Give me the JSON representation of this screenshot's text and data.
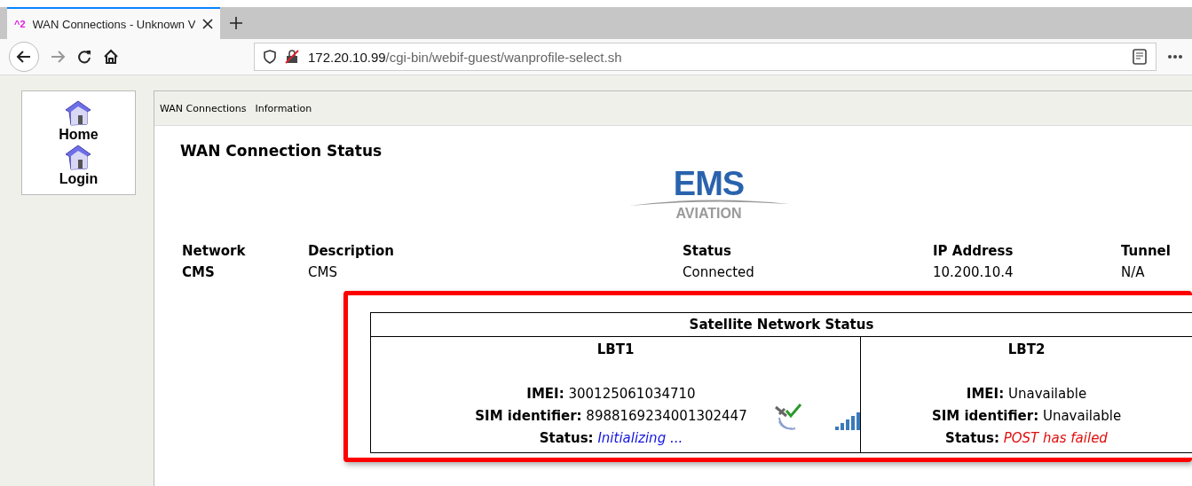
{
  "browser": {
    "tab": {
      "badge": "^2",
      "title": "WAN Connections - Unknown V",
      "selected": true
    },
    "url": {
      "host": "172.20.10.99",
      "path": "/cgi-bin/webif-guest/wanprofile-select.sh"
    }
  },
  "sidebar": {
    "items": [
      {
        "label": "Home"
      },
      {
        "label": "Login"
      }
    ]
  },
  "menu": [
    "WAN Connections",
    "Information"
  ],
  "title": "WAN Connection Status",
  "logo": {
    "name": "EMS",
    "sub": "AVIATION"
  },
  "table": {
    "columns": [
      "Network",
      "Description",
      "Status",
      "IP Address",
      "Tunnel"
    ],
    "rows": [
      {
        "cells": [
          "CMS",
          "CMS",
          "Connected",
          "10.200.10.4",
          "N/A"
        ]
      }
    ]
  },
  "satellite": {
    "title": "Satellite Network Status",
    "highlighted": true,
    "units": [
      {
        "name": "LBT1",
        "imei_label": "IMEI:",
        "imei": "300125061034710",
        "sim_label": "SIM identifier:",
        "sim": "8988169234001302447",
        "status_label": "Status:",
        "status": "Initializing ...",
        "color": "#1515e0",
        "indicators": true
      },
      {
        "name": "LBT2",
        "imei_label": "IMEI:",
        "imei": "Unavailable",
        "sim_label": "SIM identifier:",
        "sim": "Unavailable",
        "status_label": "Status:",
        "status": "POST has failed",
        "color": "#e01010",
        "indicators": false
      }
    ]
  }
}
